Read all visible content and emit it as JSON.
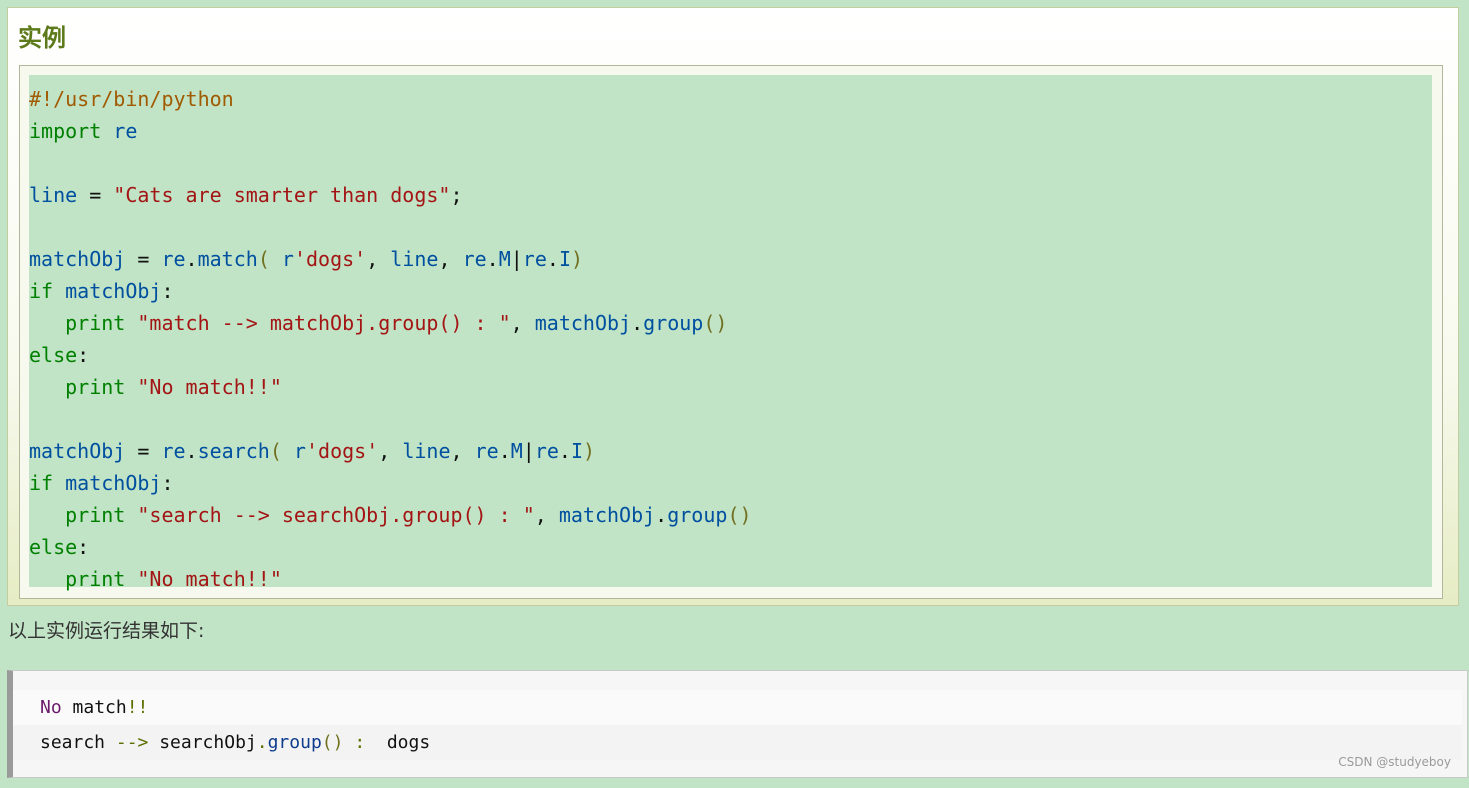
{
  "example": {
    "title": "实例",
    "code_lines": [
      [
        {
          "t": "#!/usr/bin/python",
          "c": "com"
        }
      ],
      [
        {
          "t": "import",
          "c": "kw"
        },
        {
          "t": " ",
          "c": "pun"
        },
        {
          "t": "re",
          "c": "id"
        }
      ],
      [],
      [
        {
          "t": "line",
          "c": "id"
        },
        {
          "t": " = ",
          "c": "pun"
        },
        {
          "t": "\"Cats are smarter than dogs\"",
          "c": "str"
        },
        {
          "t": ";",
          "c": "pun"
        }
      ],
      [],
      [
        {
          "t": "matchObj",
          "c": "id"
        },
        {
          "t": " = ",
          "c": "pun"
        },
        {
          "t": "re",
          "c": "id"
        },
        {
          "t": ".",
          "c": "pun"
        },
        {
          "t": "match",
          "c": "id"
        },
        {
          "t": "(",
          "c": "par"
        },
        {
          "t": " r",
          "c": "id"
        },
        {
          "t": "'dogs'",
          "c": "str"
        },
        {
          "t": ", ",
          "c": "pun"
        },
        {
          "t": "line",
          "c": "id"
        },
        {
          "t": ", ",
          "c": "pun"
        },
        {
          "t": "re",
          "c": "id"
        },
        {
          "t": ".",
          "c": "pun"
        },
        {
          "t": "M",
          "c": "id"
        },
        {
          "t": "|",
          "c": "pun"
        },
        {
          "t": "re",
          "c": "id"
        },
        {
          "t": ".",
          "c": "pun"
        },
        {
          "t": "I",
          "c": "id"
        },
        {
          "t": ")",
          "c": "par"
        }
      ],
      [
        {
          "t": "if",
          "c": "kw"
        },
        {
          "t": " ",
          "c": "pun"
        },
        {
          "t": "matchObj",
          "c": "id"
        },
        {
          "t": ":",
          "c": "pun"
        }
      ],
      [
        {
          "t": "   ",
          "c": "pun"
        },
        {
          "t": "print",
          "c": "kw"
        },
        {
          "t": " ",
          "c": "pun"
        },
        {
          "t": "\"match --> matchObj.group() : \"",
          "c": "str"
        },
        {
          "t": ", ",
          "c": "pun"
        },
        {
          "t": "matchObj",
          "c": "id"
        },
        {
          "t": ".",
          "c": "pun"
        },
        {
          "t": "group",
          "c": "id"
        },
        {
          "t": "()",
          "c": "par"
        }
      ],
      [
        {
          "t": "else",
          "c": "kw"
        },
        {
          "t": ":",
          "c": "pun"
        }
      ],
      [
        {
          "t": "   ",
          "c": "pun"
        },
        {
          "t": "print",
          "c": "kw"
        },
        {
          "t": " ",
          "c": "pun"
        },
        {
          "t": "\"No match!!\"",
          "c": "str"
        }
      ],
      [],
      [
        {
          "t": "matchObj",
          "c": "id"
        },
        {
          "t": " = ",
          "c": "pun"
        },
        {
          "t": "re",
          "c": "id"
        },
        {
          "t": ".",
          "c": "pun"
        },
        {
          "t": "search",
          "c": "id"
        },
        {
          "t": "(",
          "c": "par"
        },
        {
          "t": " r",
          "c": "id"
        },
        {
          "t": "'dogs'",
          "c": "str"
        },
        {
          "t": ", ",
          "c": "pun"
        },
        {
          "t": "line",
          "c": "id"
        },
        {
          "t": ", ",
          "c": "pun"
        },
        {
          "t": "re",
          "c": "id"
        },
        {
          "t": ".",
          "c": "pun"
        },
        {
          "t": "M",
          "c": "id"
        },
        {
          "t": "|",
          "c": "pun"
        },
        {
          "t": "re",
          "c": "id"
        },
        {
          "t": ".",
          "c": "pun"
        },
        {
          "t": "I",
          "c": "id"
        },
        {
          "t": ")",
          "c": "par"
        }
      ],
      [
        {
          "t": "if",
          "c": "kw"
        },
        {
          "t": " ",
          "c": "pun"
        },
        {
          "t": "matchObj",
          "c": "id"
        },
        {
          "t": ":",
          "c": "pun"
        }
      ],
      [
        {
          "t": "   ",
          "c": "pun"
        },
        {
          "t": "print",
          "c": "kw"
        },
        {
          "t": " ",
          "c": "pun"
        },
        {
          "t": "\"search --> searchObj.group() : \"",
          "c": "str"
        },
        {
          "t": ", ",
          "c": "pun"
        },
        {
          "t": "matchObj",
          "c": "id"
        },
        {
          "t": ".",
          "c": "pun"
        },
        {
          "t": "group",
          "c": "id"
        },
        {
          "t": "()",
          "c": "par"
        }
      ],
      [
        {
          "t": "else",
          "c": "kw"
        },
        {
          "t": ":",
          "c": "pun"
        }
      ],
      [
        {
          "t": "   ",
          "c": "pun"
        },
        {
          "t": "print",
          "c": "kw"
        },
        {
          "t": " ",
          "c": "pun"
        },
        {
          "t": "\"No match!!\"",
          "c": "str"
        }
      ]
    ]
  },
  "result": {
    "caption": "以上实例运行结果如下:",
    "output_lines": [
      [
        {
          "t": "No",
          "c": "kw"
        },
        {
          "t": " match",
          "c": "plain"
        },
        {
          "t": "!!",
          "c": "op"
        }
      ],
      [
        {
          "t": "search ",
          "c": "plain"
        },
        {
          "t": "-->",
          "c": "op"
        },
        {
          "t": " searchObj",
          "c": "plain"
        },
        {
          "t": ".",
          "c": "op"
        },
        {
          "t": "group",
          "c": "id"
        },
        {
          "t": "()",
          "c": "par"
        },
        {
          "t": " ",
          "c": "plain"
        },
        {
          "t": ":",
          "c": "op"
        },
        {
          "t": "  dogs",
          "c": "plain"
        }
      ]
    ]
  },
  "watermark": "CSDN @studyeboy",
  "colors": {
    "page_bg": "#c1e3c6",
    "title": "#5c7a1a",
    "keyword": "#008000",
    "identifier": "#0050a0",
    "string": "#a31515",
    "comment": "#a05a00"
  }
}
